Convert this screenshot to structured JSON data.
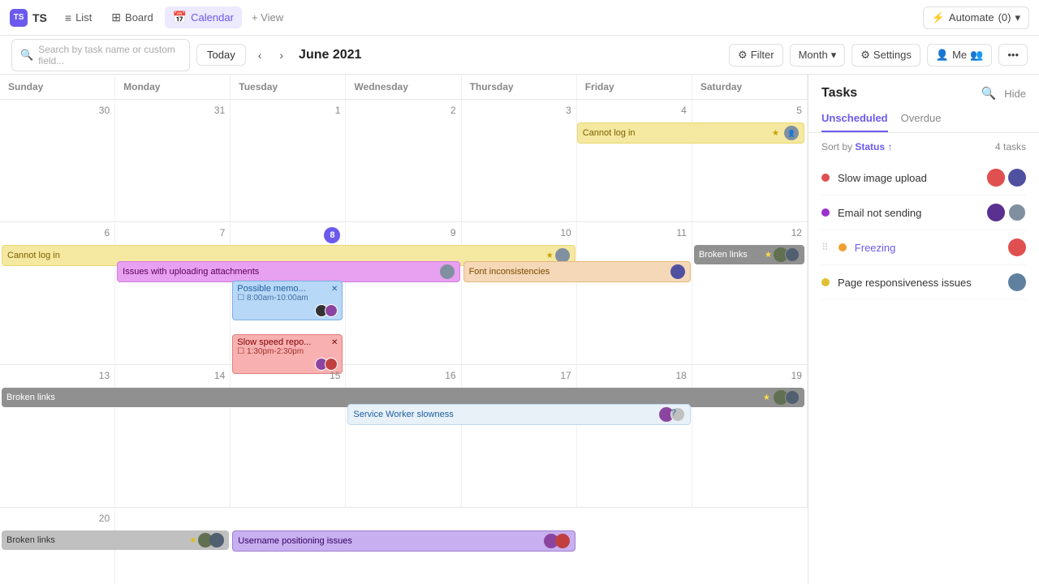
{
  "app": {
    "logo": "TS"
  },
  "nav": {
    "tabs": [
      {
        "id": "list",
        "label": "List",
        "icon": "≡",
        "active": false
      },
      {
        "id": "board",
        "label": "Board",
        "icon": "⊞",
        "active": false
      },
      {
        "id": "calendar",
        "label": "Calendar",
        "icon": "📅",
        "active": true
      }
    ],
    "add_view": "+ View",
    "automate": "Automate",
    "automate_count": "(0)"
  },
  "toolbar": {
    "search_placeholder": "Search by task name or custom field...",
    "today": "Today",
    "month_title": "June 2021",
    "filter": "Filter",
    "month": "Month",
    "settings": "Settings",
    "me": "Me",
    "users_icon": "👥"
  },
  "calendar": {
    "day_headers": [
      "Sunday",
      "Monday",
      "Tuesday",
      "Wednesday",
      "Thursday",
      "Friday",
      "Saturday"
    ],
    "weeks": [
      {
        "dates": [
          null,
          null,
          1,
          2,
          3,
          4,
          5
        ],
        "date_nums": [
          "30",
          "31",
          "1",
          "2",
          "3",
          "4",
          "5"
        ]
      },
      {
        "dates": [
          6,
          7,
          8,
          9,
          10,
          11,
          12
        ],
        "date_nums": [
          "6",
          "7",
          "8",
          "9",
          "10",
          "11",
          "12"
        ]
      },
      {
        "dates": [
          13,
          14,
          15,
          16,
          17,
          18,
          19
        ],
        "date_nums": [
          "13",
          "14",
          "15",
          "16",
          "17",
          "18",
          "19"
        ]
      }
    ],
    "events": {
      "week0_cannot_log_in": {
        "label": "Cannot log in",
        "color": "#f5e6a3",
        "textColor": "#7a6e00",
        "starColor": "#e8b000",
        "col_start": 5,
        "col_end": 7
      },
      "week1_cannot_log_in": {
        "label": "Cannot log in",
        "color": "#f5e6a3",
        "textColor": "#7a6e00",
        "col_start": 0,
        "col_end": 5
      },
      "week1_broken_links": {
        "label": "Broken links",
        "color": "#b0b0b0",
        "textColor": "#fff",
        "col_start": 6,
        "col_end": 7
      },
      "week1_issues_uploading": {
        "label": "Issues with uploading attachments",
        "color": "#e8a0f0",
        "textColor": "#5a005a",
        "col_start": 1,
        "col_end": 4
      },
      "week2_broken_links": {
        "label": "Broken links",
        "color": "#b0b0b0",
        "textColor": "#fff",
        "col_start": 0,
        "col_end": 7
      },
      "week2_service_worker": {
        "label": "Service Worker slowness",
        "color": "#e8f0f8",
        "textColor": "#333",
        "col_start": 3,
        "col_end": 6
      },
      "week3_broken_links": {
        "label": "Broken links",
        "color": "#b0b0b0",
        "textColor": "#fff",
        "col_start": 0,
        "col_end": 2
      },
      "week3_username": {
        "label": "Username positioning issues",
        "color": "#c8b0f0",
        "textColor": "#333",
        "col_start": 2,
        "col_end": 5
      }
    }
  },
  "tasks_panel": {
    "title": "Tasks",
    "tabs": [
      {
        "id": "unscheduled",
        "label": "Unscheduled",
        "active": true
      },
      {
        "id": "overdue",
        "label": "Overdue",
        "active": false
      }
    ],
    "sort_label": "Sort by",
    "sort_field": "Status",
    "tasks_count": "4 tasks",
    "tasks": [
      {
        "id": "slow-image",
        "name": "Slow image upload",
        "dot_color": "#e05050",
        "avatar_color": "#e05050"
      },
      {
        "id": "email-not-sending",
        "name": "Email not sending",
        "dot_color": "#9b30d0",
        "avatar_color": "#5a3090"
      },
      {
        "id": "freezing",
        "name": "Freezing",
        "dot_color": "#f0a030",
        "is_link": true,
        "avatar_color": "#e05050"
      },
      {
        "id": "page-responsiveness",
        "name": "Page responsiveness issues",
        "dot_color": "#e0c030",
        "avatar_color": "#6080a0"
      }
    ]
  }
}
